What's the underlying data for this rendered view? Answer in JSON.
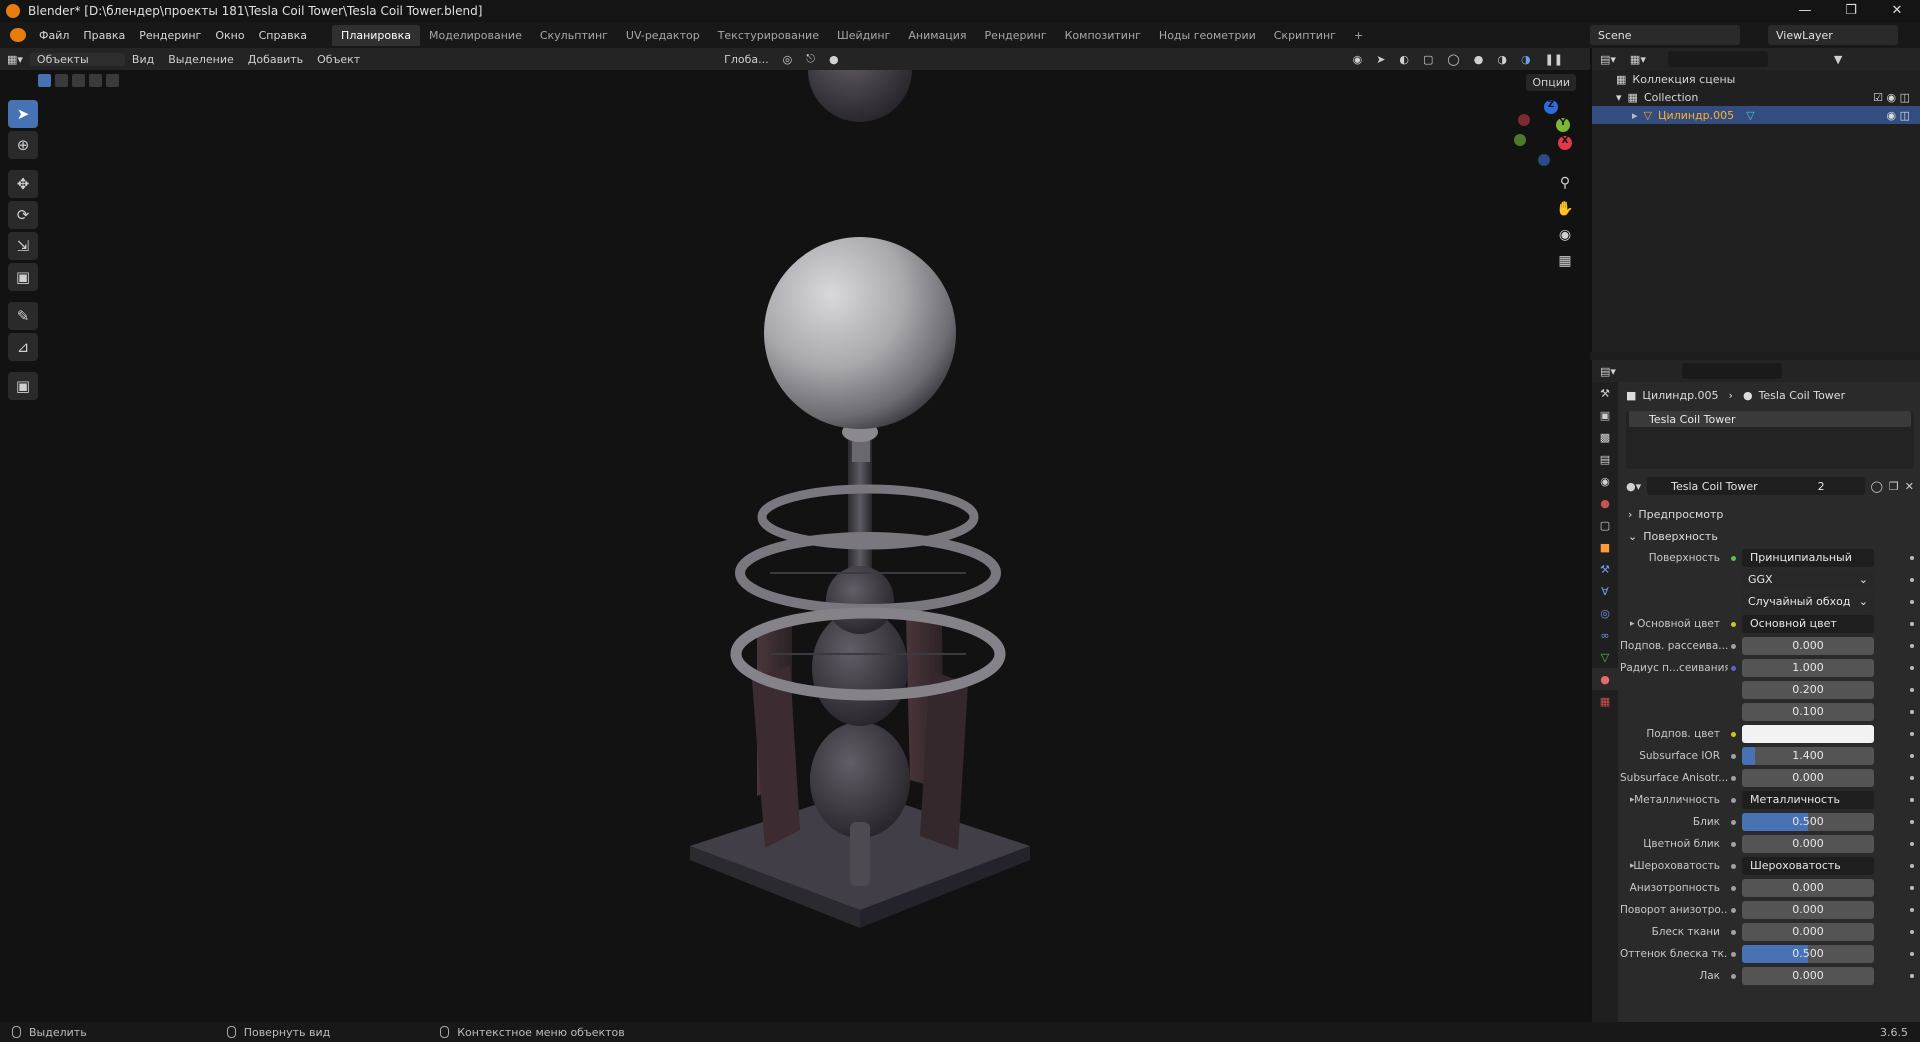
{
  "window": {
    "title": "Blender* [D:\\блендер\\проекты 181\\Tesla Coil Tower\\Tesla Coil Tower.blend]"
  },
  "menu": [
    "Файл",
    "Правка",
    "Рендеринг",
    "Окно",
    "Справка"
  ],
  "workspaces": [
    "Планировка",
    "Моделирование",
    "Скульптинг",
    "UV-редактор",
    "Текстурирование",
    "Шейдинг",
    "Анимация",
    "Рендеринг",
    "Композитинг",
    "Ноды геометрии",
    "Скриптинг"
  ],
  "scene": {
    "name": "Scene",
    "view_layer": "ViewLayer"
  },
  "viewport_header": {
    "mode": "Объекты",
    "view": "Вид",
    "select": "Выделение",
    "add": "Добавить",
    "object": "Объект",
    "orientation": "Глоба...",
    "options": "Опции"
  },
  "outliner": {
    "scene_collection": "Коллекция сцены",
    "collection": "Collection",
    "object": "Цилиндр.005"
  },
  "properties": {
    "object": "Цилиндр.005",
    "material": "Tesla Coil Tower",
    "slot": "Tesla Coil Tower",
    "users": "2",
    "preview": "Предпросмотр",
    "surface_section": "Поверхность",
    "rows": [
      {
        "label": "Поверхность",
        "value": "Принципиальный BSDF",
        "kind": "link",
        "dot": "#52c452"
      },
      {
        "label": "",
        "value": "GGX",
        "kind": "select"
      },
      {
        "label": "",
        "value": "Случайный обход",
        "kind": "select"
      },
      {
        "label": "Основной цвет",
        "value": "Основной цвет",
        "kind": "link",
        "dot": "#c7c729",
        "arrow": true
      },
      {
        "label": "Подпов. рассеива...",
        "value": "0.000",
        "kind": "num",
        "dot": "#a1a1a1"
      },
      {
        "label": "Радиус п...сеивания",
        "value": "1.000",
        "kind": "num",
        "dot": "#6363c7"
      },
      {
        "label": "",
        "value": "0.200",
        "kind": "num"
      },
      {
        "label": "",
        "value": "0.100",
        "kind": "num"
      },
      {
        "label": "Подпов. цвет",
        "value": "",
        "kind": "color",
        "dot": "#c7c729"
      },
      {
        "label": "Subsurface IOR",
        "value": "1.400",
        "kind": "slider",
        "fill": 0.1,
        "dot": "#a1a1a1"
      },
      {
        "label": "Subsurface Anisotr...",
        "value": "0.000",
        "kind": "num",
        "dot": "#a1a1a1"
      },
      {
        "label": "Металличность",
        "value": "Металличность",
        "kind": "link",
        "dot": "#a1a1a1",
        "arrow": true
      },
      {
        "label": "Блик",
        "value": "0.500",
        "kind": "slider",
        "fill": 0.5,
        "dot": "#a1a1a1"
      },
      {
        "label": "Цветной блик",
        "value": "0.000",
        "kind": "num",
        "dot": "#a1a1a1"
      },
      {
        "label": "Шероховатость",
        "value": "Шероховатость",
        "kind": "link",
        "dot": "#a1a1a1",
        "arrow": true
      },
      {
        "label": "Анизотропность",
        "value": "0.000",
        "kind": "num",
        "dot": "#a1a1a1"
      },
      {
        "label": "Поворот анизотро...",
        "value": "0.000",
        "kind": "num",
        "dot": "#a1a1a1"
      },
      {
        "label": "Блеск ткани",
        "value": "0.000",
        "kind": "num",
        "dot": "#a1a1a1"
      },
      {
        "label": "Оттенок блеска тк...",
        "value": "0.500",
        "kind": "slider",
        "fill": 0.5,
        "dot": "#a1a1a1"
      },
      {
        "label": "Лак",
        "value": "0.000",
        "kind": "num",
        "dot": "#a1a1a1"
      }
    ]
  },
  "status": {
    "select": "Выделить",
    "rotate": "Повернуть вид",
    "context": "Контекстное меню объектов",
    "version": "3.6.5"
  }
}
